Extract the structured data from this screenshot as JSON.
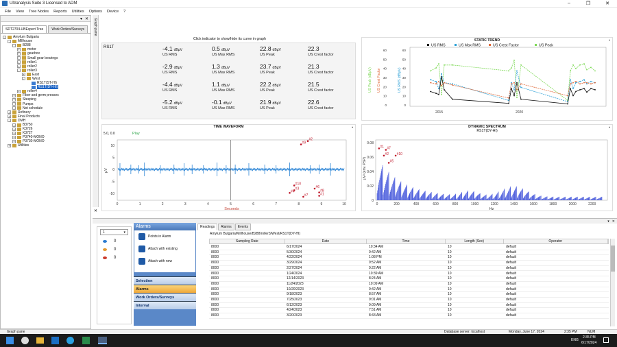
{
  "window": {
    "title": "Ultranalysis Suite 3 Licensed to ADM",
    "min": "–",
    "max": "❐",
    "close": "✕"
  },
  "menu": [
    "File",
    "View",
    "Tree Nodes",
    "Reports",
    "Utilities",
    "Options",
    "Device",
    "?"
  ],
  "left_pane": {
    "tabs": [
      "SDT270/LUBExpert Tree",
      "Work Orders/Surveys"
    ],
    "pin": "▾",
    "close": "✕"
  },
  "tree": [
    {
      "label": "Amylum Bulgaria",
      "depth": 0,
      "tog": "-"
    },
    {
      "label": "Millhouse",
      "depth": 1,
      "tog": "-"
    },
    {
      "label": "B288",
      "depth": 2,
      "tog": "-"
    },
    {
      "label": "motor",
      "depth": 3,
      "tog": "+"
    },
    {
      "label": "gearbox",
      "depth": 3,
      "tog": "+"
    },
    {
      "label": "Small gear bearings",
      "depth": 3,
      "tog": "+"
    },
    {
      "label": "roller1",
      "depth": 3,
      "tog": "+"
    },
    {
      "label": "roller2",
      "depth": 3,
      "tog": "+"
    },
    {
      "label": "roller3",
      "depth": 3,
      "tog": "-"
    },
    {
      "label": "East",
      "depth": 4,
      "tog": "+"
    },
    {
      "label": "West",
      "depth": 4,
      "tog": "-"
    },
    {
      "label": "RS1T(ST-HI)",
      "depth": 5,
      "tog": ""
    },
    {
      "label": "RS1T(DY-HI)",
      "depth": 5,
      "tog": "",
      "selected": true
    },
    {
      "label": "roller4",
      "depth": 3,
      "tog": "+"
    },
    {
      "label": "Fiber and germ presses",
      "depth": 2,
      "tog": "+"
    },
    {
      "label": "Steeping",
      "depth": 2,
      "tog": "+"
    },
    {
      "label": "Pumps",
      "depth": 2,
      "tog": "+"
    },
    {
      "label": "Not schedule",
      "depth": 2,
      "tog": "+"
    },
    {
      "label": "Refinery",
      "depth": 1,
      "tog": "+"
    },
    {
      "label": "Final Products",
      "depth": 1,
      "tog": "+"
    },
    {
      "label": "DMH",
      "depth": 1,
      "tog": "-"
    },
    {
      "label": "B3750",
      "depth": 2,
      "tog": "+"
    },
    {
      "label": "K3726",
      "depth": 2,
      "tog": "+"
    },
    {
      "label": "K3727",
      "depth": 2,
      "tog": "+"
    },
    {
      "label": "P3740-MONO",
      "depth": 2,
      "tog": "+"
    },
    {
      "label": "P3730-MONO",
      "depth": 2,
      "tog": "+"
    },
    {
      "label": "Utilities",
      "depth": 1,
      "tog": "+"
    }
  ],
  "graph_pane_strip": "Graph pane",
  "click_hint": "Click indicator to show/hide its curve in graph",
  "indicators": {
    "sensor": "RS1T",
    "rows": [
      [
        {
          "v": "-4.1",
          "u": "dBµV",
          "l": "US RMS"
        },
        {
          "v": "0.5",
          "u": "dBµV",
          "l": "US Max RMS"
        },
        {
          "v": "22.8",
          "u": "dBµV",
          "l": "US Peak"
        },
        {
          "v": "22.3",
          "u": "",
          "l": "US Crest factor"
        }
      ],
      [
        {
          "v": "-2.9",
          "u": "dBµV",
          "l": "US RMS"
        },
        {
          "v": "1.3",
          "u": "dBµV",
          "l": "US Max RMS"
        },
        {
          "v": "23.7",
          "u": "dBµV",
          "l": "US Peak"
        },
        {
          "v": "21.3",
          "u": "",
          "l": "US Crest factor"
        }
      ],
      [
        {
          "v": "-4.4",
          "u": "dBµV",
          "l": "US RMS"
        },
        {
          "v": "1.1",
          "u": "dBµV",
          "l": "US Max RMS"
        },
        {
          "v": "22.2",
          "u": "dBµV",
          "l": "US Peak"
        },
        {
          "v": "21.5",
          "u": "",
          "l": "US Crest factor"
        }
      ],
      [
        {
          "v": "-5.2",
          "u": "dBµV",
          "l": "US RMS"
        },
        {
          "v": "-0.1",
          "u": "dBµV",
          "l": "US Max RMS"
        },
        {
          "v": "21.9",
          "u": "dBµV",
          "l": "US Peak"
        },
        {
          "v": "22.6",
          "u": "",
          "l": "US Crest factor"
        }
      ]
    ]
  },
  "colors": {
    "rms": "#111111",
    "maxrms": "#2a9fd6",
    "crest": "#e06a3a",
    "peak": "#7ed957",
    "wave": "#2e86d6",
    "spectrum": "#2b3fd6",
    "marker": "#c0182a"
  },
  "static_trend": {
    "title": "STATIC TREND",
    "legend": [
      "US RMS",
      "US Max RMS",
      "US Crest Factor",
      "US Peak"
    ],
    "axis_labels": [
      "US Peak (dBµV)",
      "US Crest Factor",
      "US RMS (dBµV)"
    ],
    "y_ticks": [
      "60",
      "50",
      "40",
      "30",
      "20",
      "10",
      "0"
    ],
    "x_ticks": [
      "2015",
      "2020"
    ]
  },
  "waveform": {
    "title": "TIME WAVEFORM",
    "play": "Play",
    "counter": "5.0, 0.0",
    "xlabel": "Seconds",
    "ylabel": "µV",
    "x_ticks": [
      "0",
      "1",
      "2",
      "3",
      "4",
      "5",
      "6",
      "7",
      "8",
      "9",
      "10"
    ],
    "y_ticks": [
      "10",
      "5",
      "0",
      "-5",
      "-10"
    ],
    "markers": [
      "#2",
      "#9",
      "#10",
      "#3",
      "#6",
      "#8",
      "#1",
      "#7",
      "#4"
    ]
  },
  "spectrum": {
    "title": "DYNAMIC SPECTRUM",
    "subtitle": "RS1T(DY-HI)",
    "xlabel": "Hz",
    "ylabel": "µV² (env. PSP)",
    "x_ticks": [
      "0",
      "200",
      "400",
      "600",
      "800",
      "1000",
      "1200",
      "1400",
      "1600",
      "1800",
      "2000",
      "2200"
    ],
    "y_ticks": [
      "0.08",
      "0.06",
      "0.04",
      "0.02",
      "0"
    ],
    "markers": [
      "#1",
      "#7",
      "#2",
      "#5",
      "#10"
    ]
  },
  "side_box": {
    "select": "1",
    "counts": [
      "0",
      "0",
      "0"
    ]
  },
  "alarm_nav": {
    "header": "Alarms",
    "items": [
      "Points in Alarm",
      "Attach with existing",
      "Attach with new"
    ],
    "bars": [
      "Selection",
      "Alarms",
      "Work Orders/Surveys",
      "Interval"
    ]
  },
  "readings": {
    "tabs": [
      "Readings",
      "Alarms",
      "Events"
    ],
    "path": "Amylum Bulgaria/Millhouse/B288/roller3/West/RS1T(DY-HI)",
    "columns": [
      "Sampling Rate",
      "Date",
      "Time",
      "Length (Sec)",
      "Operator"
    ],
    "rows": [
      [
        "8000",
        "6/17/2024",
        "10:34 AM",
        "10",
        "default"
      ],
      [
        "8000",
        "5/30/2024",
        "9:42 AM",
        "10",
        "default"
      ],
      [
        "8000",
        "4/22/2024",
        "1:08 PM",
        "10",
        "default"
      ],
      [
        "8000",
        "3/29/2024",
        "9:52 AM",
        "10",
        "default"
      ],
      [
        "8000",
        "2/27/2024",
        "9:22 AM",
        "10",
        "default"
      ],
      [
        "8000",
        "1/24/2024",
        "10:39 AM",
        "10",
        "default"
      ],
      [
        "8000",
        "12/14/2023",
        "8:24 AM",
        "10",
        "default"
      ],
      [
        "8000",
        "11/24/2023",
        "10:09 AM",
        "10",
        "default"
      ],
      [
        "8000",
        "10/20/2023",
        "9:42 AM",
        "10",
        "default"
      ],
      [
        "8000",
        "9/18/2023",
        "8:57 AM",
        "10",
        "default"
      ],
      [
        "8000",
        "7/25/2023",
        "9:01 AM",
        "10",
        "default"
      ],
      [
        "8000",
        "6/12/2023",
        "9:09 AM",
        "10",
        "default"
      ],
      [
        "8000",
        "4/24/2023",
        "7:51 AM",
        "10",
        "default"
      ],
      [
        "8000",
        "3/20/2023",
        "8:43 AM",
        "10",
        "default"
      ]
    ]
  },
  "status": {
    "graph_pane": "Graph pane",
    "server": "Database server: localhost",
    "date": "Monday, June 17, 2024",
    "time": "2:35 PM",
    "num": "NUM"
  },
  "taskbar": {
    "clock_time": "2:35 PM",
    "clock_date": "6/17/2024",
    "lang": "ENG"
  }
}
